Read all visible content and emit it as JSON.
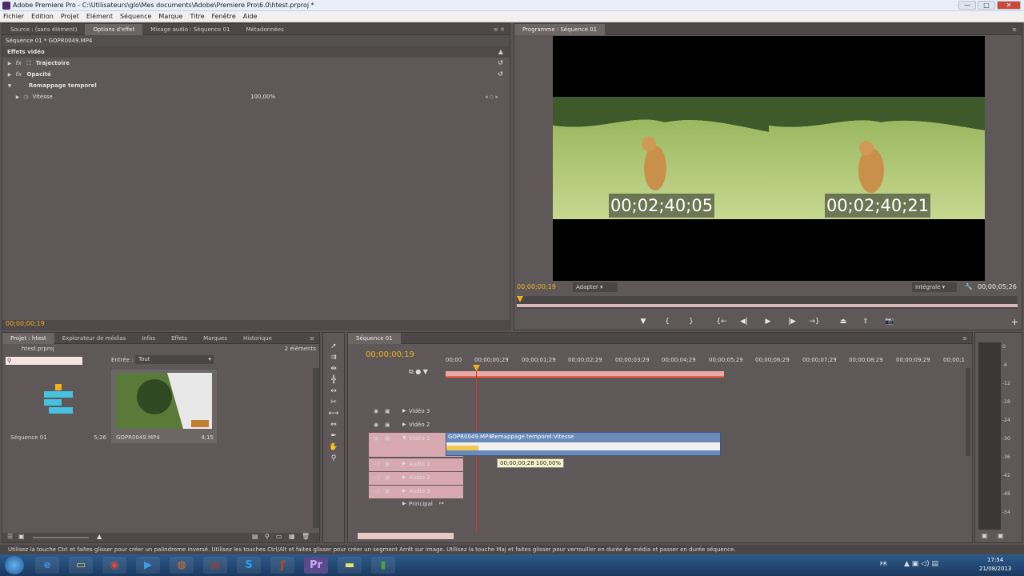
{
  "window": {
    "title": "Adobe Premiere Pro - C:\\Utilisateurs\\glo\\Mes documents\\Adobe\\Premiere Pro\\6.0\\htest.prproj *",
    "minimize": "—",
    "maximize": "□",
    "close": "✕"
  },
  "menu": [
    "Fichier",
    "Edition",
    "Projet",
    "Elément",
    "Séquence",
    "Marque",
    "Titre",
    "Fenêtre",
    "Aide"
  ],
  "effects_panel": {
    "tabs": [
      "Source : (sans élément)",
      "Options d'effet",
      "Mixage audio : Séquence 01",
      "Métadonnées"
    ],
    "clip_header": "Séquence 01 * GOPR0049.MP4",
    "section": "Effets vidéo",
    "rows": [
      {
        "label": "Trajectoire",
        "prefix": "fx"
      },
      {
        "label": "Opacité",
        "prefix": "fx"
      },
      {
        "label": "Remappage temporel",
        "prefix": ""
      }
    ],
    "speed_label": "Vitesse",
    "speed_value": "100,00%",
    "timecode": "00;00;00;19"
  },
  "program_monitor": {
    "tab": "Programme : Séquence 01",
    "left_timecode_overlay": "00;02;40;05",
    "right_timecode_overlay": "00;02;40;21",
    "current_time": "00;00;00;19",
    "fit_label": "Adapter",
    "quality_label": "Intégrale",
    "duration": "00;00;05;26"
  },
  "project_panel": {
    "tabs": [
      "Projet : htest",
      "Explorateur de médias",
      "Infos",
      "Effets",
      "Marques",
      "Historique"
    ],
    "file": "htest.prproj",
    "count": "2 éléments",
    "entry_label": "Entrée :",
    "entry_value": "Tout",
    "items": [
      {
        "name": "Séquence 01",
        "duration": "5;26"
      },
      {
        "name": "GOPR0049.MP4",
        "duration": "4;15"
      }
    ]
  },
  "timeline": {
    "tab": "Séquence 01",
    "timecode": "00;00;00;19",
    "ruler": [
      "00;00",
      "00;00;00;29",
      "00;00;01;29",
      "00;00;02;29",
      "00;00;03;29",
      "00;00;04;29",
      "00;00;05;29",
      "00;00;06;29",
      "00;00;07;29",
      "00;00;08;29",
      "00;00;09;29",
      "00;00;1"
    ],
    "video_tracks": [
      "Vidéo 3",
      "Vidéo 2",
      "Vidéo 1"
    ],
    "audio_tracks": [
      "Audio 1",
      "Audio 2",
      "Audio 3"
    ],
    "master": "Principal",
    "clip_name": "GOPR0049.MP4",
    "clip_effect": "Remappage temporel:Vitesse",
    "tooltip": "00;00;00;28 100,00%"
  },
  "vu_meter": {
    "ticks": [
      "0",
      "-6",
      "-12",
      "-18",
      "-24",
      "-30",
      "-36",
      "-42",
      "-48",
      "-54"
    ]
  },
  "status": "Utilisez la touche Ctrl et faites glisser pour créer un palindrome inversé. Utilisez les touches Ctrl/Alt et faites glisser pour créer un segment Arrêt sur image. Utilisez la touche Maj et faites glisser pour verrouiller en durée de média et passer en durée séquence.",
  "taskbar": {
    "lang": "FR",
    "time": "17:54",
    "date": "21/08/2013",
    "apps": [
      {
        "name": "internet-explorer",
        "glyph": "e",
        "color": "#3a8fd8"
      },
      {
        "name": "file-explorer",
        "glyph": "▭",
        "color": "#e8c25a"
      },
      {
        "name": "chrome",
        "glyph": "◉",
        "color": "#d9463b"
      },
      {
        "name": "media-player",
        "glyph": "▶",
        "color": "#3aa0e0"
      },
      {
        "name": "firefox",
        "glyph": "◍",
        "color": "#e07020"
      },
      {
        "name": "winrar",
        "glyph": "▤",
        "color": "#a0402a"
      },
      {
        "name": "skype",
        "glyph": "S",
        "color": "#2aa0e8"
      },
      {
        "name": "flash",
        "glyph": "ƒ",
        "color": "#c84020"
      },
      {
        "name": "premiere",
        "glyph": "Pr",
        "color": "#2c1a4a"
      },
      {
        "name": "notes",
        "glyph": "▬",
        "color": "#e8e070"
      },
      {
        "name": "camtasia",
        "glyph": "▮",
        "color": "#4aa040"
      }
    ]
  }
}
